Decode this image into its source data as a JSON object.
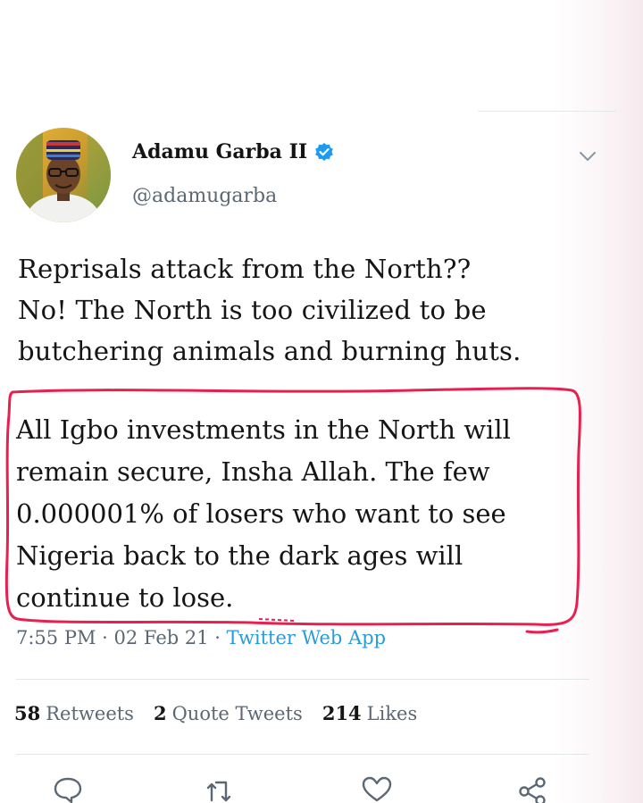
{
  "tweet": {
    "author": {
      "display_name": "Adamu Garba II",
      "handle": "@adamugarba",
      "verified": true
    },
    "text_lines": [
      "Reprisals attack from the North??",
      "No! The North is too civilized to be",
      "butchering animals and burning huts."
    ],
    "highlighted_lines": [
      "All Igbo investments in the North will",
      "remain secure, Insha Allah. The few",
      "0.000001% of losers who want to see",
      "Nigeria back to the dark ages will",
      "continue to lose."
    ],
    "meta": {
      "time": "7:55 PM",
      "separator": "·",
      "date": "02 Feb 21",
      "source": "Twitter Web App"
    },
    "stats": {
      "retweets_count": "58",
      "retweets_label": "Retweets",
      "quotes_count": "2",
      "quotes_label": "Quote Tweets",
      "likes_count": "214",
      "likes_label": "Likes"
    },
    "actions": [
      "reply-icon",
      "retweet-icon",
      "like-icon",
      "share-icon"
    ]
  },
  "colors": {
    "annotation_stroke": "#e8204f",
    "link_blue": "#2a9bd8",
    "verified_blue": "#1d9bf0",
    "secondary_text": "#5b6873"
  }
}
